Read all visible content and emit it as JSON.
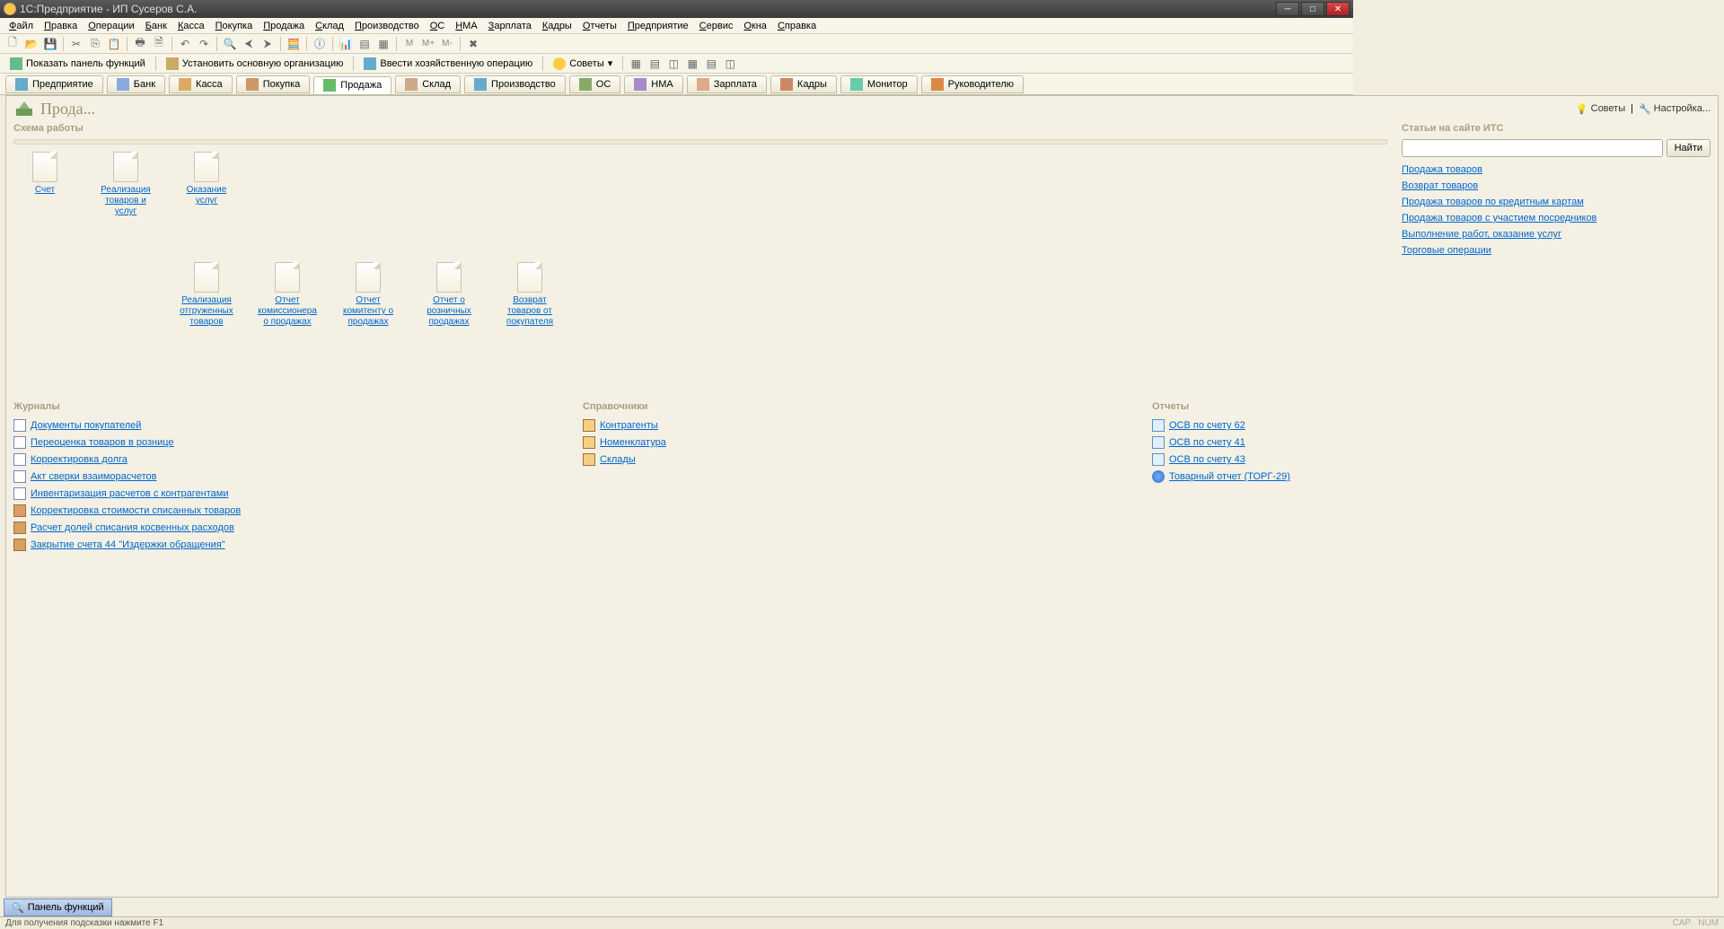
{
  "window": {
    "title": "1С:Предприятие - ИП Сусеров С.А."
  },
  "menus": [
    "Файл",
    "Правка",
    "Операции",
    "Банк",
    "Касса",
    "Покупка",
    "Продажа",
    "Склад",
    "Производство",
    "ОС",
    "НМА",
    "Зарплата",
    "Кадры",
    "Отчеты",
    "Предприятие",
    "Сервис",
    "Окна",
    "Справка"
  ],
  "toolbar2": {
    "b1": "Показать панель функций",
    "b2": "Установить основную организацию",
    "b3": "Ввести хозяйственную операцию",
    "b4": "Советы"
  },
  "tabs": [
    {
      "label": "Предприятие"
    },
    {
      "label": "Банк"
    },
    {
      "label": "Касса"
    },
    {
      "label": "Покупка"
    },
    {
      "label": "Продажа",
      "active": true
    },
    {
      "label": "Склад"
    },
    {
      "label": "Производство"
    },
    {
      "label": "ОС"
    },
    {
      "label": "НМА"
    },
    {
      "label": "Зарплата"
    },
    {
      "label": "Кадры"
    },
    {
      "label": "Монитор"
    },
    {
      "label": "Руководителю"
    }
  ],
  "page": {
    "title": "Прода...",
    "advice": "Советы",
    "settings": "Настройка..."
  },
  "scheme": {
    "title": "Схема работы",
    "row1": [
      {
        "label": "Счет"
      },
      {
        "label": "Реализация товаров и услуг"
      },
      {
        "label": "Оказание услуг"
      }
    ],
    "row2": [
      {
        "label": "Реализация отгруженных товаров"
      },
      {
        "label": "Отчет комиссионера о продажах"
      },
      {
        "label": "Отчет комитенту о продажах"
      },
      {
        "label": "Отчет о розничных продажах"
      },
      {
        "label": "Возврат товаров от покупателя"
      }
    ]
  },
  "its": {
    "title": "Статьи на сайте ИТС",
    "find": "Найти",
    "links": [
      "Продажа товаров",
      "Возврат товаров",
      "Продажа товаров по кредитным картам",
      "Продажа товаров с участием посредников",
      "Выполнение работ, оказание услуг",
      "Торговые операции"
    ]
  },
  "journals": {
    "title": "Журналы",
    "items": [
      "Документы покупателей",
      "Переоценка товаров в рознице",
      "Корректировка долга",
      "Акт сверки взаиморасчетов",
      "Инвентаризация расчетов с контрагентами",
      "Корректировка стоимости списанных товаров",
      "Расчет долей списания косвенных расходов",
      "Закрытие счета 44 \"Издержки обращения\""
    ]
  },
  "refs": {
    "title": "Справочники",
    "items": [
      "Контрагенты",
      "Номенклатура",
      "Склады"
    ]
  },
  "reports": {
    "title": "Отчеты",
    "items": [
      "ОСВ по счету 62",
      "ОСВ по счету 41",
      "ОСВ по счету 43",
      "Товарный отчет (ТОРГ-29)"
    ]
  },
  "bottomTab": "Панель функций",
  "status": {
    "hint": "Для получения подсказки нажмите F1",
    "cap": "CAP",
    "num": "NUM"
  }
}
